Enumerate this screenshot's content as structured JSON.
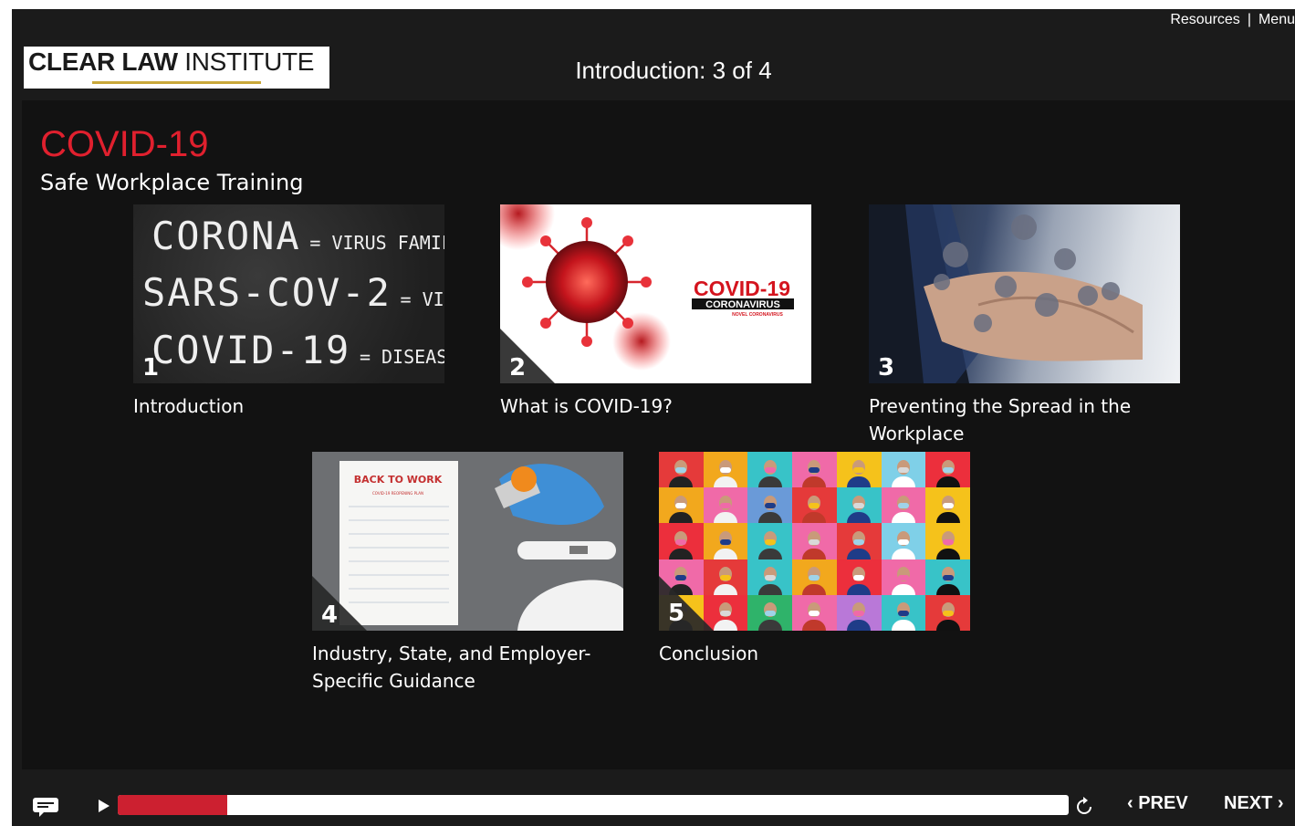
{
  "header": {
    "resources_label": "Resources",
    "separator": "|",
    "menu_label": "Menu",
    "logo_bold": "CLEAR LAW",
    "logo_light": "INSTITUTE",
    "slide_title": "Introduction: 3 of 4"
  },
  "slide": {
    "brand_title": "COVID-19",
    "brand_subtitle": "Safe Workplace Training",
    "cards": [
      {
        "number": "1",
        "label": "Introduction",
        "thumb_text": {
          "line1_big": "CORONA",
          "line1_small": "= VIRUS FAMILY",
          "line2_big": "SARS-COV-2",
          "line2_small": "= VIRUS",
          "line3_big": "COVID-19",
          "line3_small": "= DISEASE"
        }
      },
      {
        "number": "2",
        "label": "What is COVID-19?",
        "thumb_text": {
          "title": "COVID-19",
          "banner": "CORONAVIRUS",
          "sub": "NOVEL CORONAVIRUS"
        }
      },
      {
        "number": "3",
        "label": "Preventing the Spread in the Workplace"
      },
      {
        "number": "4",
        "label": "Industry, State, and Employer-Specific Guidance",
        "thumb_text": {
          "note_title": "BACK TO WORK",
          "note_sub": "COVID-19 REOPENING PLAN"
        }
      },
      {
        "number": "5",
        "label": "Conclusion"
      }
    ]
  },
  "player": {
    "progress_fraction": 0.115,
    "prev_label": "‹ PREV",
    "next_label": "NEXT ›"
  },
  "colors": {
    "accent_red": "#e0202e",
    "progress_fill": "#cc2030",
    "background": "#121212",
    "logo_underline": "#c9a83a"
  },
  "icons": [
    "captions-icon",
    "play-icon",
    "replay-icon"
  ]
}
